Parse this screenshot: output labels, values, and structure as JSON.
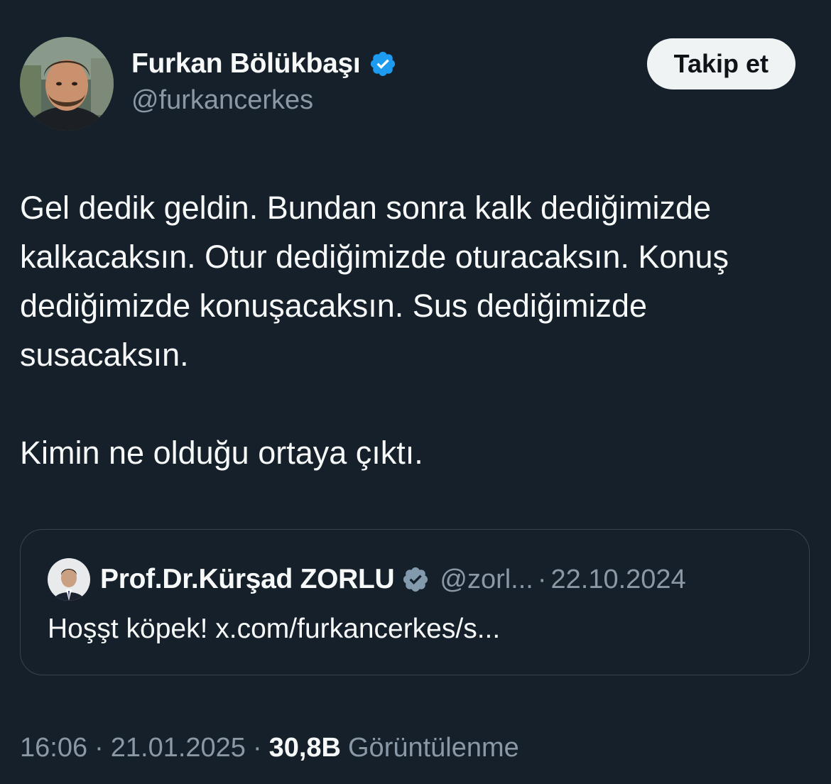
{
  "author": {
    "display_name": "Furkan Bölükbaşı",
    "handle": "@furkancerkes",
    "verified": true,
    "avatar_icon": "user-photo-avatar"
  },
  "follow_button": {
    "label": "Takip et"
  },
  "tweet": {
    "paragraph_1": "Gel dedik geldin. Bundan sonra kalk dediğimizde kalkacaksın. Otur dediğimizde oturacaksın. Konuş dediğimizde konuşacaksın. Sus dediğimizde susacaksın.",
    "paragraph_2": "Kimin ne olduğu ortaya çıktı."
  },
  "quote": {
    "display_name": "Prof.Dr.Kürşad ZORLU",
    "handle": "@zorl...",
    "separator": "·",
    "date": "22.10.2024",
    "text": "Hoşşt köpek! x.com/furkancerkes/s...",
    "verified_badge": "gray-verified-icon"
  },
  "meta": {
    "time": "16:06",
    "separator": "·",
    "date": "21.01.2025",
    "views_count": "30,8B",
    "views_label": "Görüntülenme"
  },
  "colors": {
    "background": "#15202b",
    "text_primary": "#f7f9f9",
    "text_secondary": "#8b98a5",
    "verified_blue": "#1d9bf0",
    "verified_gray": "#829aab",
    "border": "#38444d",
    "button_bg": "#eff3f4"
  }
}
